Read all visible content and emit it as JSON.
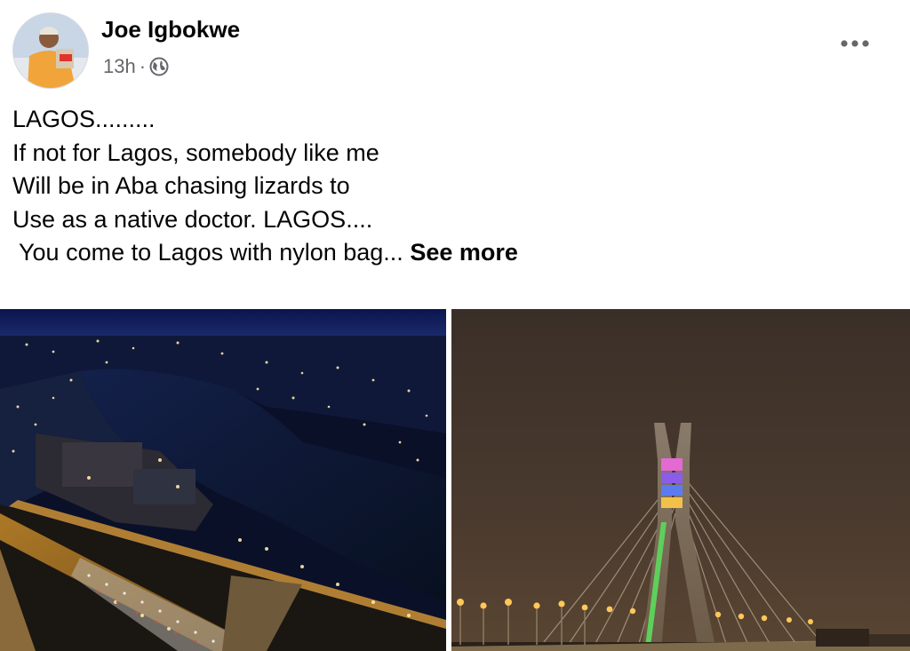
{
  "post": {
    "author": "Joe Igbokwe",
    "time": "13h",
    "separator": "·",
    "privacy_icon": "globe-icon",
    "more_icon": "more-horizontal-icon",
    "lines": [
      "LAGOS.........",
      "If not for Lagos, somebody like me",
      "Will be in Aba chasing lizards to",
      "Use as a native doctor. LAGOS....",
      " You come to Lagos with nylon bag... "
    ],
    "see_more": "See more"
  },
  "photos": [
    {
      "subject": "aerial view of Lagos city at night"
    },
    {
      "subject": "Lekki-Ikoyi link bridge at night"
    }
  ],
  "colors": {
    "text": "#050505",
    "secondary_text": "#65676b"
  }
}
